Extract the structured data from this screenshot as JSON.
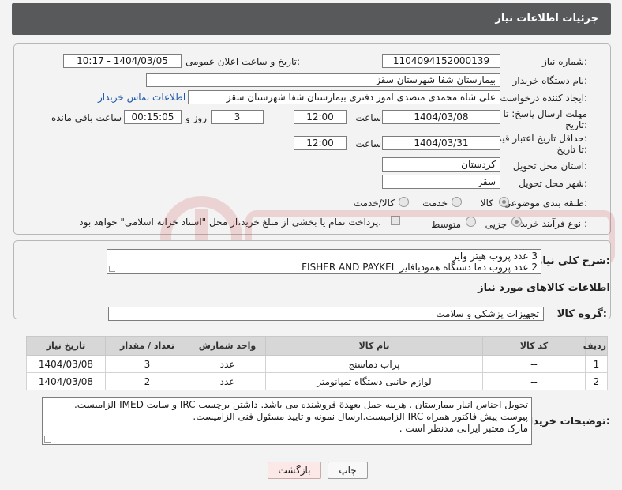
{
  "header": {
    "title": "جزئیات اطلاعات نیاز"
  },
  "form": {
    "need_number": {
      "label": "شماره نیاز:",
      "value": "1104094152000139"
    },
    "announce_datetime": {
      "label": "تاریخ و ساعت اعلان عمومی:",
      "value": "1404/03/05 - 10:17"
    },
    "buyer_org": {
      "label": "نام دستگاه خریدار:",
      "value": "بیمارستان شفا شهرستان سقز"
    },
    "requester": {
      "label": "ایجاد کننده درخواست:",
      "value": "علی شاه محمدی متصدی امور دفتری بیمارستان شفا شهرستان سقز",
      "contact_link": "اطلاعات تماس خریدار"
    },
    "response_deadline": {
      "label_line1": "مهلت ارسال پاسخ: تا",
      "label_line2": "تاریخ:",
      "date": "1404/03/08",
      "time_label": "ساعت",
      "time": "12:00",
      "days": "3",
      "days_label": "روز و",
      "remaining": "00:15:05",
      "remaining_label": "ساعت باقی مانده"
    },
    "price_validity": {
      "label_line1": "حداقل تاریخ اعتبار قیمت:",
      "label_line2": "تا تاریخ:",
      "date": "1404/03/31",
      "time_label": "ساعت",
      "time": "12:00"
    },
    "delivery_province": {
      "label": "استان محل تحویل:",
      "value": "کردستان"
    },
    "delivery_city": {
      "label": "شهر محل تحویل:",
      "value": "سقز"
    },
    "category": {
      "label": "طبقه بندی موضوعی:",
      "options": [
        "کالا",
        "خدمت",
        "کالا/خدمت"
      ],
      "selected": "کالا"
    },
    "purchase_process": {
      "label": "نوع فرآیند خرید :",
      "options": [
        "جزیی",
        "متوسط"
      ],
      "selected": "جزیی",
      "payment_note": "پرداخت تمام یا بخشی از مبلغ خرید،از محل \"اسناد خزانه اسلامی\" خواهد بود."
    }
  },
  "summary": {
    "label": "شرح کلی نیاز:",
    "lines": [
      "3 عدد پروب هیتر وایر",
      "2 عدد پروب دما دستگاه همودیافایر  FISHER AND PAYKEL"
    ]
  },
  "goods_section": {
    "title": "اطلاعات کالاهای مورد نیاز",
    "group_label": "گروه کالا:",
    "group_value": "تجهیزات پزشکی و سلامت",
    "table": {
      "headers": [
        "ردیف",
        "کد کالا",
        "نام کالا",
        "واحد شمارش",
        "تعداد / مقدار",
        "تاریخ نیاز"
      ],
      "rows": [
        [
          "1",
          "--",
          "پراب دماسنج",
          "عدد",
          "3",
          "1404/03/08"
        ],
        [
          "2",
          "--",
          "لوازم جانبی دستگاه تمپانومتر",
          "عدد",
          "2",
          "1404/03/08"
        ]
      ]
    }
  },
  "buyer_notes": {
    "label": "توضیحات خریدار:",
    "lines": [
      "تحویل اجناس  انبار بیمارستان . هزینه حمل بعهدة فروشنده می باشد.  داشتن برچسب IRC  و سایت  IMED  الزامیست.",
      "پیوست پیش فاکتور همراه IRC  الزامیست.ارسال نمونه و تایید مسئول فنی الزامیست.",
      "مارک معتبر ایرانی مدنظر است ."
    ]
  },
  "buttons": {
    "print": "چاپ",
    "back": "بازگشت"
  },
  "colors": {
    "header_bg": "#58595b",
    "link": "#1a56a8",
    "table_header": "#d7d7d7"
  }
}
